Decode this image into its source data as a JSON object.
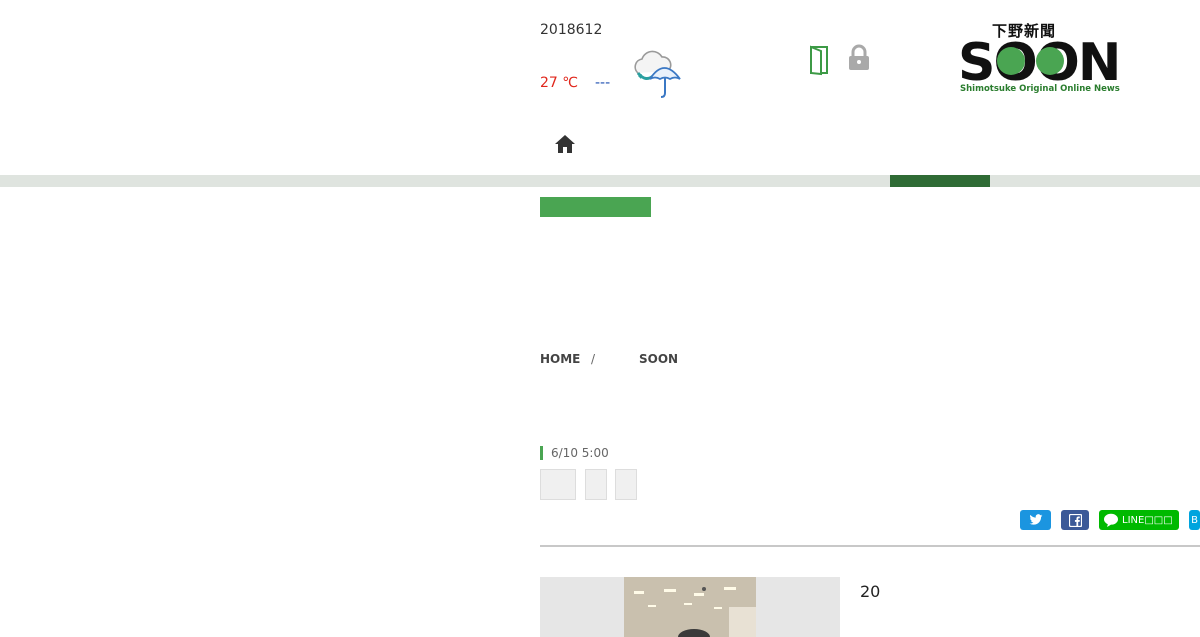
{
  "header": {
    "date": "2018612",
    "temp_high": "27 ℃",
    "temp_low": "---",
    "weather_icon": "cloud-rain-umbrella-icon",
    "door_icon": "door-icon",
    "lock_icon": "lock-icon"
  },
  "logo": {
    "japanese": "下野新聞",
    "name": "SOON",
    "tagline": "Shimotsuke Original Online News"
  },
  "nav": {
    "home_icon": "home-icon"
  },
  "breadcrumb": {
    "home": "HOME",
    "separator": "/",
    "current": "SOON"
  },
  "article": {
    "timestamp": "6/10 5:00",
    "year_text": "20"
  },
  "share": {
    "line_label": "LINE□□□"
  },
  "colors": {
    "brand_green": "#4aa552",
    "nav_active": "#2f6b35",
    "temp_high": "#e0261b",
    "temp_low": "#1e4fb0"
  }
}
